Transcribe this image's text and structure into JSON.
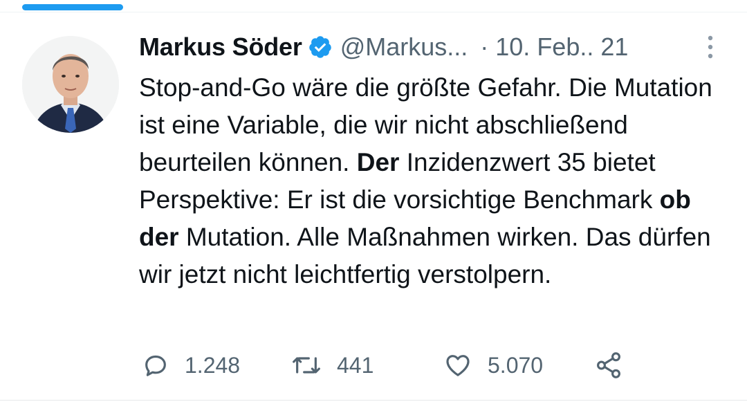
{
  "tweet": {
    "author_name": "Markus Söder",
    "handle": "@Markus...",
    "separator": "·",
    "date": "10. Feb.. 21",
    "text": {
      "part1": "Stop-and-Go wäre die größte Gefahr. Die Mutation ist eine Variable, die wir nicht abschließend beurteilen können. ",
      "bold1": "Der",
      "part2": " Inzidenzwert 35 bietet Perspektive: Er ist die vorsichtige Benchmark ",
      "bold2": "ob der",
      "part3": " Mutation. Alle Maßnahmen wirken. Das dürfen wir jetzt nicht leichtfertig verstolpern."
    },
    "stats": {
      "replies": "1.248",
      "retweets": "441",
      "likes": "5.070"
    }
  },
  "icons": {
    "verified": "verified-badge-icon",
    "more": "more-vertical-icon",
    "reply": "reply-icon",
    "retweet": "retweet-icon",
    "like": "heart-icon",
    "share": "share-icon"
  },
  "colors": {
    "accent": "#1d9bf0",
    "text": "#0f1419",
    "secondary": "#536471"
  }
}
